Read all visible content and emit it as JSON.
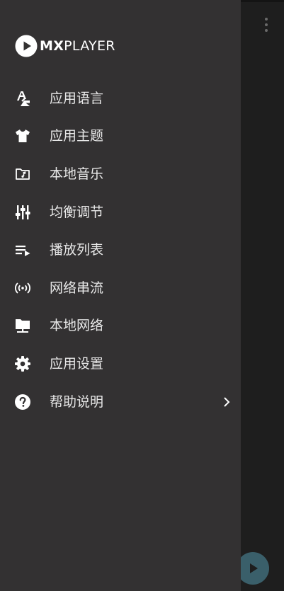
{
  "app": {
    "logo_text_bold": "MX",
    "logo_text_regular": "PLAYER"
  },
  "drawer": {
    "items": [
      {
        "label": "应用语言",
        "icon": "language-icon"
      },
      {
        "label": "应用主题",
        "icon": "tshirt-icon"
      },
      {
        "label": "本地音乐",
        "icon": "music-folder-icon"
      },
      {
        "label": "均衡调节",
        "icon": "equalizer-icon"
      },
      {
        "label": "播放列表",
        "icon": "playlist-icon"
      },
      {
        "label": "网络串流",
        "icon": "stream-icon"
      },
      {
        "label": "本地网络",
        "icon": "network-folder-icon"
      },
      {
        "label": "应用设置",
        "icon": "gear-icon"
      },
      {
        "label": "帮助说明",
        "icon": "help-icon",
        "has_chevron": true
      }
    ]
  },
  "colors": {
    "drawer_bg": "#333132",
    "background": "#1e1e1e",
    "text": "#e8e8e8",
    "fab": "#3a5f6a"
  }
}
